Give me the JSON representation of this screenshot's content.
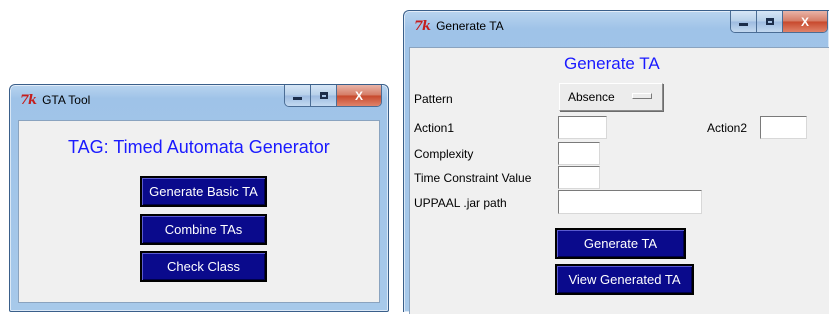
{
  "gta_tool": {
    "title": "GTA Tool",
    "icon": "tk-icon",
    "heading": "TAG: Timed Automata Generator",
    "buttons": [
      "Generate Basic TA",
      "Combine TAs",
      "Check Class"
    ],
    "controls": {
      "close_label": "X"
    }
  },
  "generate_ta": {
    "title": "Generate TA",
    "icon": "tk-icon",
    "heading": "Generate TA",
    "pattern_label": "Pattern",
    "pattern_value": "Absence",
    "action1_label": "Action1",
    "action2_label": "Action2",
    "complexity_label": "Complexity",
    "time_constraint_label": "Time Constraint Value",
    "uppaal_label": "UPPAAL .jar path",
    "action1_value": "",
    "action2_value": "",
    "complexity_value": "",
    "time_constraint_value": "",
    "uppaal_value": "",
    "generate_button": "Generate TA",
    "view_button": "View Generated TA",
    "controls": {
      "close_label": "X"
    }
  },
  "colors": {
    "heading": "#1a1aff",
    "button_bg": "#0a0a8c",
    "client_bg": "#f0f0f0",
    "tk_icon": "#c41e1e"
  }
}
